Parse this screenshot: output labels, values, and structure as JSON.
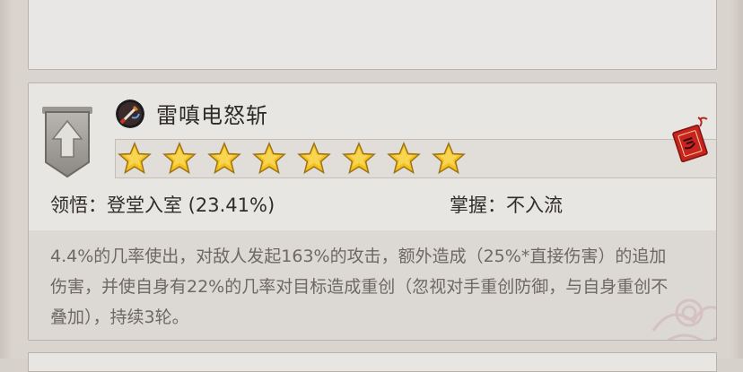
{
  "skill": {
    "name": "雷嗔电怒斩",
    "icon": "sword-icon",
    "badge_icon": "upgrade-arrow-icon",
    "seal_icon": "red-seal-tag-icon",
    "stars": 8,
    "comprehension_label": "领悟：登堂入室 (23.41%)",
    "mastery_label": "掌握：不入流",
    "description": "4.4%的几率使出，对敌人发起163%的攻击，额外造成（25%*直接伤害）的追加伤害，并使自身有22%的几率对目标造成重创（忽视对手重创防御，与自身重创不叠加），持续3轮。"
  },
  "colors": {
    "star_gold": "#f5c21d",
    "seal_red": "#c8231e",
    "accent_text": "#2d2a28"
  }
}
